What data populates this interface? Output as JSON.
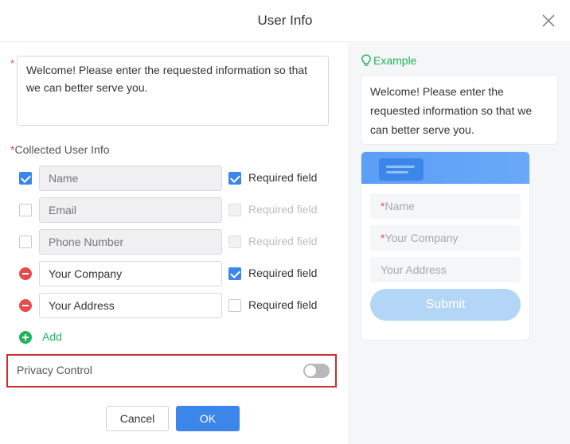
{
  "dialog": {
    "title": "User Info"
  },
  "welcome_message": "Welcome! Please enter the requested information so that we can better serve you.",
  "collected_info": {
    "label": "Collected User Info",
    "rows": [
      {
        "lead": "checkbox-checked",
        "value": "",
        "placeholder": "Name",
        "disabled": true,
        "required_checked": true,
        "required_disabled": false
      },
      {
        "lead": "checkbox",
        "value": "",
        "placeholder": "Email",
        "disabled": true,
        "required_checked": false,
        "required_disabled": true
      },
      {
        "lead": "checkbox",
        "value": "",
        "placeholder": "Phone Number",
        "disabled": true,
        "required_checked": false,
        "required_disabled": true
      },
      {
        "lead": "remove",
        "value": "Your Company",
        "placeholder": "",
        "disabled": false,
        "required_checked": true,
        "required_disabled": false
      },
      {
        "lead": "remove",
        "value": "Your Address",
        "placeholder": "",
        "disabled": false,
        "required_checked": false,
        "required_disabled": false
      }
    ],
    "required_label": "Required field",
    "add_label": "Add"
  },
  "privacy": {
    "label": "Privacy Control",
    "enabled": false
  },
  "buttons": {
    "cancel": "Cancel",
    "ok": "OK"
  },
  "example": {
    "label": "Example",
    "bubble_text": "Welcome! Please enter the requested information so that we can better serve you.",
    "fields": [
      {
        "required": true,
        "label": "Name"
      },
      {
        "required": true,
        "label": "Your Company"
      },
      {
        "required": false,
        "label": "Your Address"
      }
    ],
    "submit": "Submit"
  },
  "colors": {
    "primary": "#3b86e8",
    "success": "#22b35e",
    "danger": "#e34d4d",
    "highlight_border": "#c9302c"
  }
}
